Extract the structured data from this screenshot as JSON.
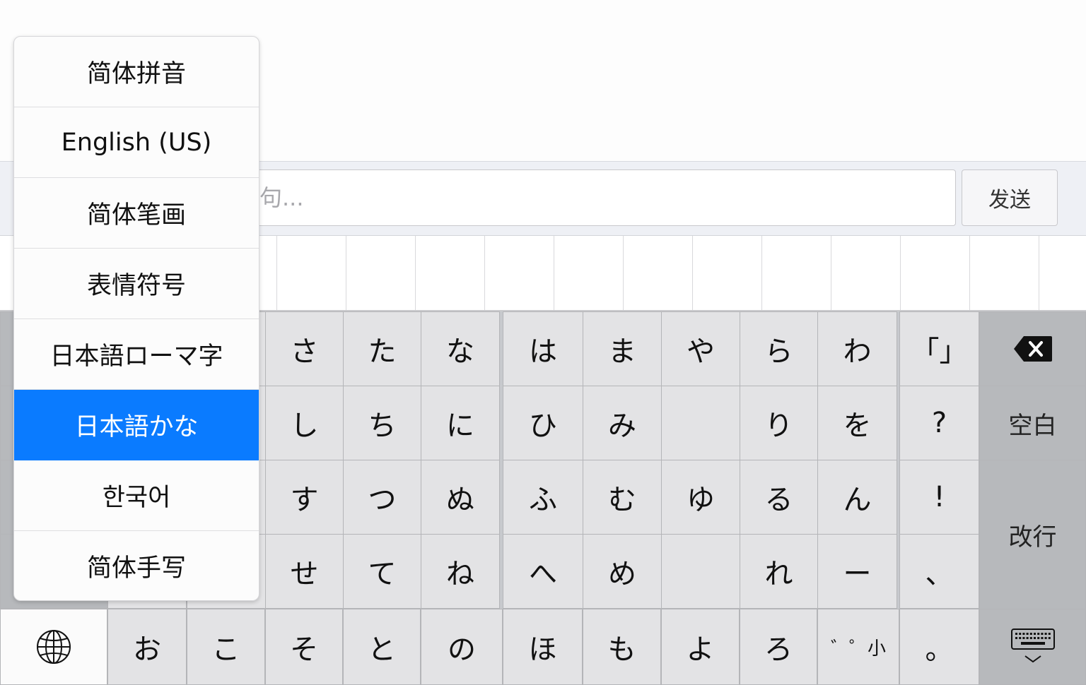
{
  "input_bar": {
    "placeholder_fragment": "句...",
    "send_label": "发送"
  },
  "language_menu": {
    "selected_index": 5,
    "items": [
      {
        "label": "简体拼音"
      },
      {
        "label": "English (US)"
      },
      {
        "label": "简体笔画"
      },
      {
        "label": "表情符号"
      },
      {
        "label": "日本語ローマ字"
      },
      {
        "label": "日本語かな"
      },
      {
        "label": "한국어"
      },
      {
        "label": "简体手写"
      }
    ]
  },
  "keyboard": {
    "rows": [
      [
        "さ",
        "た",
        "な",
        "は",
        "ま",
        "や",
        "ら",
        "わ",
        "「」"
      ],
      [
        "し",
        "ち",
        "に",
        "ひ",
        "み",
        "",
        "り",
        "を",
        "?"
      ],
      [
        "す",
        "つ",
        "ぬ",
        "ふ",
        "む",
        "ゆ",
        "る",
        "ん",
        "!"
      ],
      [
        "せ",
        "て",
        "ね",
        "へ",
        "め",
        "",
        "れ",
        "ー",
        "、"
      ]
    ],
    "bottom_row": [
      "お",
      "こ",
      "そ",
      "と",
      "の",
      "ほ",
      "も",
      "よ",
      "ろ",
      "゛゜小",
      "。"
    ],
    "space_label": "空白",
    "return_label": "改行",
    "delete_icon": "backspace-icon",
    "globe_icon": "globe-icon",
    "hide_icon": "keyboard-hide-icon"
  },
  "colors": {
    "accent": "#0a7bff"
  }
}
